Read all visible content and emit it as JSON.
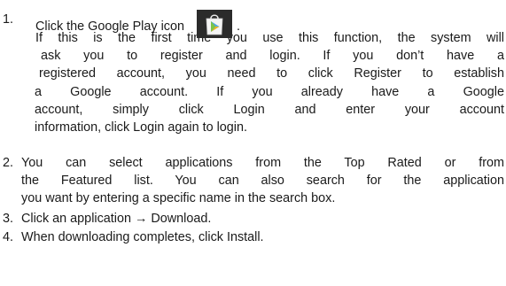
{
  "steps": [
    {
      "number": "1.",
      "lines": [
        "Click the Google Play icon",
        "If this is the first time you use this function, the system will",
        "ask you to register and login.   If you don’t have a",
        "registered account, you need to click Register to establish",
        "a  Google  account.    If  you  already  have  a  Google",
        "account,  simply  click  Login  and  enter  your  account",
        "information, click Login again to login."
      ],
      "line1_suffix": ".",
      "icon": "google-play-icon"
    },
    {
      "number": "2.",
      "lines": [
        "You can select applications from the Top Rated or from",
        "the Featured list.  You can also search for the application",
        "you want by entering a specific name in the search  box."
      ]
    },
    {
      "number": "3.",
      "lines": [
        "Click an application → Download."
      ]
    },
    {
      "number": "4.",
      "lines": [
        "When downloading completes, click Install."
      ]
    }
  ]
}
